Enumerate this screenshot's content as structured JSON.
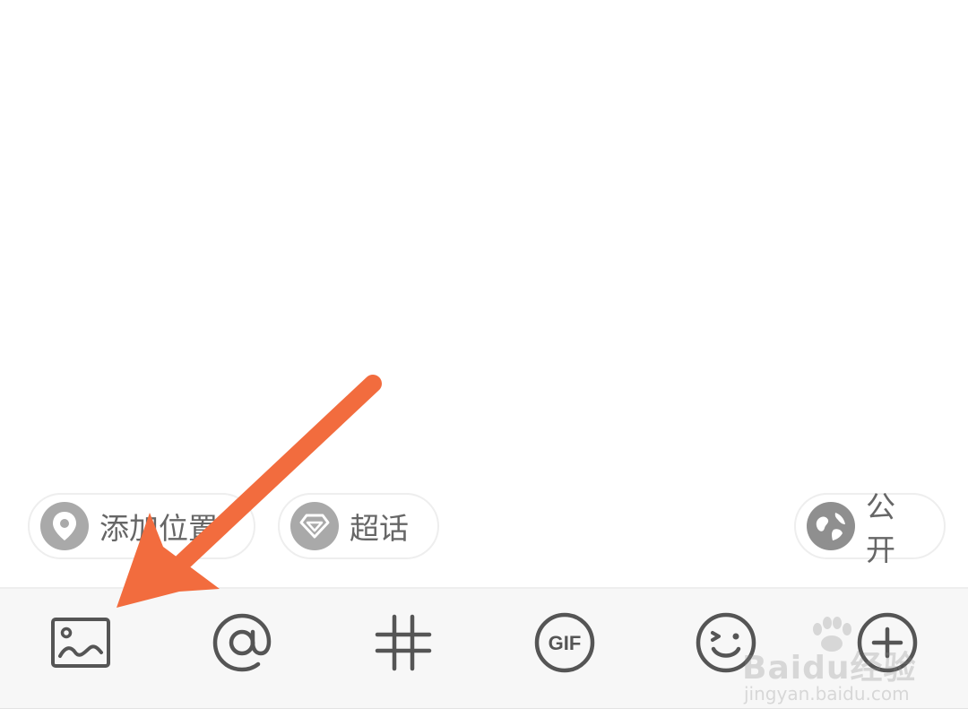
{
  "chips": {
    "location": {
      "label": "添加位置",
      "icon": "location-pin-icon"
    },
    "topic": {
      "label": "超话",
      "icon": "diamond-icon"
    },
    "visibility": {
      "label": "公开",
      "icon": "globe-icon"
    }
  },
  "toolbar": {
    "items": [
      {
        "icon": "image-icon"
      },
      {
        "icon": "at-mention-icon"
      },
      {
        "icon": "hashtag-icon"
      },
      {
        "icon": "gif-icon",
        "text": "GIF"
      },
      {
        "icon": "emoji-icon"
      },
      {
        "icon": "plus-icon"
      }
    ]
  },
  "annotation": {
    "color": "#F26C3E",
    "icon": "arrow-annotation"
  },
  "watermark": {
    "brand": "Baidu经验",
    "url": "jingyan.baidu.com"
  },
  "colors": {
    "toolbar_bg": "#f7f7f7",
    "icon": "#555555",
    "chip_icon_bg": "#a9a9a9",
    "chip_text": "#666666"
  }
}
